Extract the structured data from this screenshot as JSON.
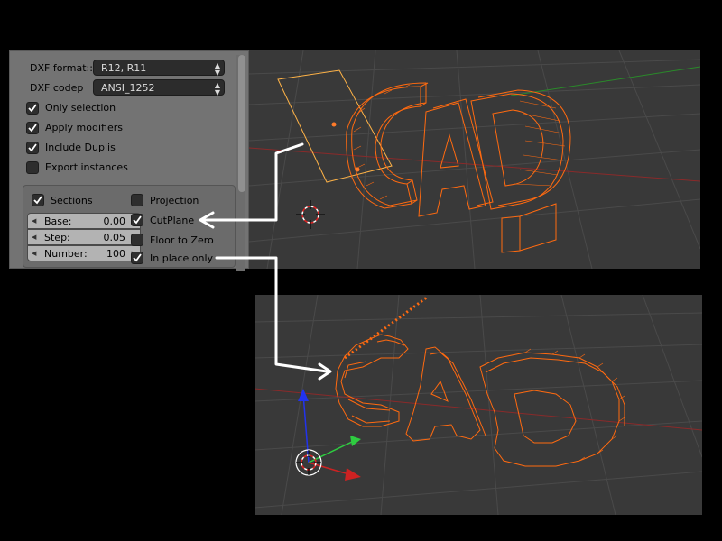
{
  "dxf_settings": {
    "format_label": "DXF format::",
    "format_value": "R12, R11",
    "codep_label": "DXF codep",
    "codep_value": "ANSI_1252",
    "checkboxes": [
      {
        "label": "Only selection",
        "checked": true
      },
      {
        "label": "Apply modifiers",
        "checked": true
      },
      {
        "label": "Include Duplis",
        "checked": true
      },
      {
        "label": "Export instances",
        "checked": false
      }
    ]
  },
  "sections": {
    "label": "Sections",
    "checked": true,
    "fields": [
      {
        "label": "Base:",
        "value": "0.00"
      },
      {
        "label": "Step:",
        "value": "0.05"
      },
      {
        "label": "Number:",
        "value": "100"
      }
    ],
    "options": [
      {
        "label": "Projection",
        "checked": false
      },
      {
        "label": "CutPlane",
        "checked": true
      },
      {
        "label": "Floor to Zero",
        "checked": false
      },
      {
        "label": "In place only",
        "checked": true
      }
    ]
  },
  "colors": {
    "wireframe": "#ff6a10",
    "selected_plane": "#ffb347",
    "viewport_bg": "#393939",
    "grid": "#4a4a4a",
    "panel_bg": "#737373",
    "x_axis": "#c33333",
    "y_axis": "#2ecc40",
    "z_axis": "#2233ee"
  },
  "icons": [
    "checkbox-checked-icon",
    "checkbox-unchecked-icon",
    "dropdown-arrows-icon",
    "3d-cursor-icon",
    "transform-gizmo-icon",
    "arrow-pointer-icon"
  ]
}
